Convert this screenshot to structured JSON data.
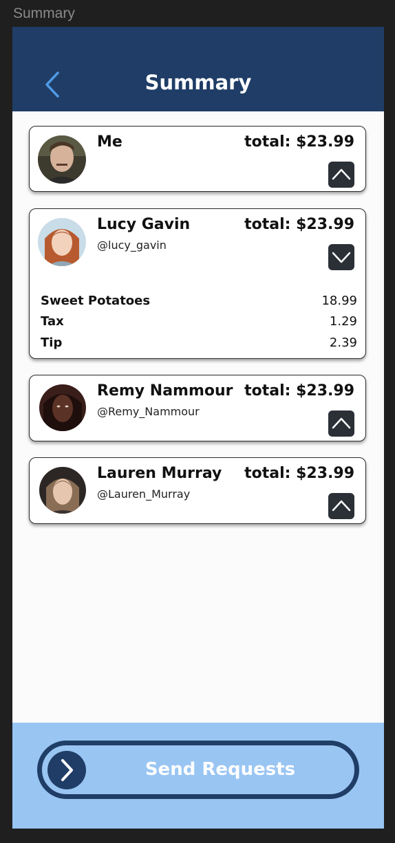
{
  "frame_label": "Summary",
  "header": {
    "title": "Summary",
    "back_icon": "chevron-left-icon",
    "background": "#1f3d66"
  },
  "people": [
    {
      "name": "Me",
      "handle": "",
      "total": "total: $23.99",
      "expanded": false,
      "toggle_icon": "chevron-up-icon"
    },
    {
      "name": "Lucy Gavin",
      "handle": "@lucy_gavin",
      "total": "total: $23.99",
      "expanded": true,
      "toggle_icon": "chevron-down-icon",
      "items": [
        {
          "name": "Sweet Potatoes",
          "value": "18.99"
        },
        {
          "name": "Tax",
          "value": "1.29"
        },
        {
          "name": "Tip",
          "value": "2.39"
        }
      ]
    },
    {
      "name": "Remy Nammour",
      "handle": "@Remy_Nammour",
      "total": "total: $23.99",
      "expanded": false,
      "toggle_icon": "chevron-up-icon"
    },
    {
      "name": "Lauren Murray",
      "handle": "@Lauren_Murray",
      "total": "total: $23.99",
      "expanded": false,
      "toggle_icon": "chevron-up-icon"
    }
  ],
  "footer": {
    "send_label": "Send Requests",
    "send_icon": "chevron-right-icon",
    "background": "#99c5f3"
  }
}
